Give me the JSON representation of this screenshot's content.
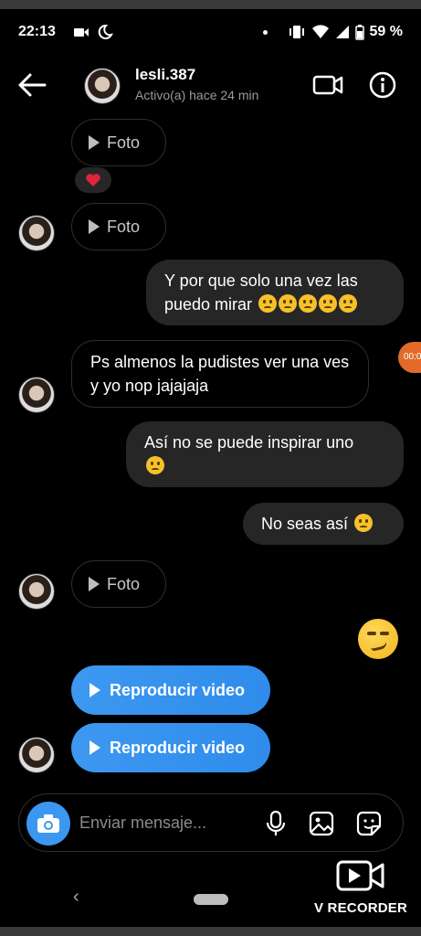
{
  "status_bar": {
    "time": "22:13",
    "battery": "59 %"
  },
  "header": {
    "username": "lesli.387",
    "activity": "Activo(a) hace 24 min"
  },
  "messages": {
    "foto_1": "Foto",
    "foto_2": "Foto",
    "reaction": "heart",
    "out_1": "Y por que solo una vez las puedo mirar",
    "in_1": "Ps almenos la pudistes ver una ves y yo nop jajajaja",
    "out_2": "Así no se puede inspirar uno",
    "out_3": "No seas así",
    "foto_3": "Foto",
    "video_1": "Reproducir video",
    "video_2": "Reproducir video"
  },
  "composer": {
    "placeholder": "Enviar mensaje..."
  },
  "watermark": {
    "label": "V RECORDER"
  },
  "colors": {
    "accent": "#3b97f0",
    "bubble_out": "#262626",
    "background": "#000000"
  }
}
